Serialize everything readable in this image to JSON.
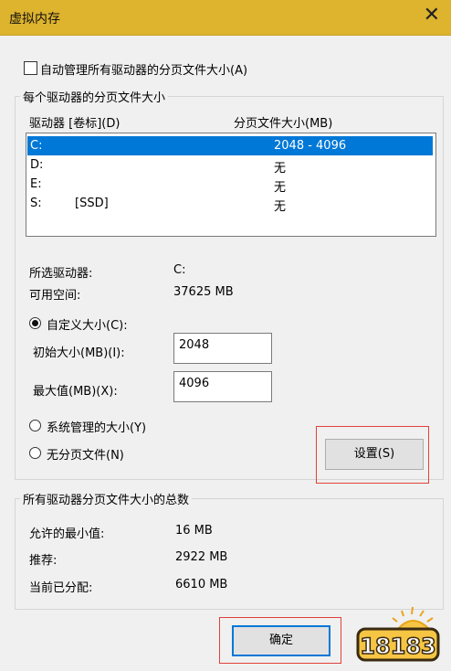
{
  "window": {
    "title": "虚拟内存",
    "close_glyph": "✕"
  },
  "auto_manage": {
    "label": "自动管理所有驱动器的分页文件大小(A)",
    "checked": false
  },
  "per_drive": {
    "legend": "每个驱动器的分页文件大小",
    "columns": {
      "drive": "驱动器 [卷标](D)",
      "size": "分页文件大小(MB)"
    },
    "rows": [
      {
        "drive": "C:",
        "label": "",
        "size": "2048 - 4096",
        "selected": true
      },
      {
        "drive": "D:",
        "label": "",
        "size": "无",
        "selected": false
      },
      {
        "drive": "E:",
        "label": "",
        "size": "无",
        "selected": false
      },
      {
        "drive": "S:",
        "label": "[SSD]",
        "size": "无",
        "selected": false
      }
    ],
    "selected_drive": {
      "label": "所选驱动器:",
      "value": "C:"
    },
    "free_space": {
      "label": "可用空间:",
      "value": "37625 MB"
    },
    "custom_size": {
      "label": "自定义大小(C):",
      "selected": true
    },
    "initial_size": {
      "label": "初始大小(MB)(I):",
      "value": "2048"
    },
    "max_size": {
      "label": "最大值(MB)(X):",
      "value": "4096"
    },
    "system_managed": {
      "label": "系统管理的大小(Y)",
      "selected": false
    },
    "no_paging": {
      "label": "无分页文件(N)",
      "selected": false
    },
    "set_button": "设置(S)"
  },
  "totals": {
    "legend": "所有驱动器分页文件大小的总数",
    "min_allowed": {
      "label": "允许的最小值:",
      "value": "16 MB"
    },
    "recommended": {
      "label": "推荐:",
      "value": "2922 MB"
    },
    "currently_allocated": {
      "label": "当前已分配:",
      "value": "6610 MB"
    }
  },
  "ok_button": "确定",
  "watermark": {
    "text": "18183"
  },
  "colors": {
    "titlebar": "#deb32d",
    "selection": "#0078d7",
    "highlight_box": "#e0413a"
  }
}
